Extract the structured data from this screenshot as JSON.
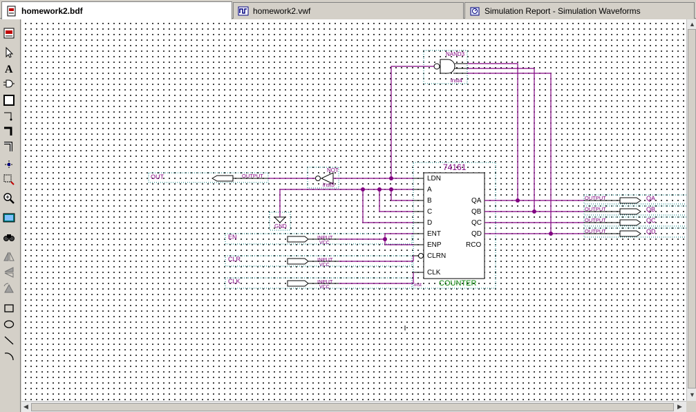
{
  "tabs": [
    {
      "label": "homework2.bdf",
      "active": true,
      "icon": "block-diagram-icon"
    },
    {
      "label": "homework2.vwf",
      "active": false,
      "icon": "waveform-icon"
    },
    {
      "label": "Simulation Report - Simulation Waveforms",
      "active": false,
      "icon": "report-icon"
    }
  ],
  "toolbar": {
    "tools": [
      "block-diagram-icon",
      "selection-tool-icon",
      "text-tool-icon",
      "symbol-tool-icon",
      "block-tool-icon",
      "orthogonal-node-tool-icon",
      "orthogonal-bus-tool-icon",
      "orthogonal-conduit-tool-icon",
      "use-rubberbanding-icon",
      "partial-line-selection-icon",
      "zoom-tool-icon",
      "full-screen-icon",
      "find-icon",
      "flip-horizontal-icon",
      "flip-vertical-icon",
      "rotate-left-icon",
      "rectangle-tool-icon",
      "oval-tool-icon",
      "line-tool-icon",
      "arc-tool-icon"
    ]
  },
  "schematic": {
    "counter": {
      "part": "74161",
      "instance": "inst",
      "category": "COUNTER",
      "inputs": [
        "LDN",
        "A",
        "B",
        "C",
        "D",
        "ENT",
        "ENP",
        "CLRN",
        "CLK"
      ],
      "outputs": [
        "QA",
        "QB",
        "QC",
        "QD",
        "RCO"
      ]
    },
    "nand": {
      "type": "NAND3",
      "instance": "inst4"
    },
    "not": {
      "type": "NOT",
      "instance": "inst5"
    },
    "gnd": {
      "label": "GND"
    },
    "input_pins": [
      {
        "name": "EN",
        "type": "INPUT",
        "default": "VCC"
      },
      {
        "name": "CLR",
        "type": "INPUT",
        "default": "VCC"
      },
      {
        "name": "CLK",
        "type": "INPUT",
        "default": "VCC"
      }
    ],
    "output_pins_right": [
      {
        "name": "QA",
        "type": "OUTPUT"
      },
      {
        "name": "QB",
        "type": "OUTPUT"
      },
      {
        "name": "QC",
        "type": "OUTPUT"
      },
      {
        "name": "QD",
        "type": "OUTPUT"
      }
    ],
    "output_pin_left": {
      "name": "OUT",
      "type": "OUTPUT"
    }
  },
  "colors": {
    "wire": "#800080",
    "symbol": "#000000",
    "counter_part": "#800080",
    "counter_category": "#008000",
    "dotted_box": "#008080"
  }
}
